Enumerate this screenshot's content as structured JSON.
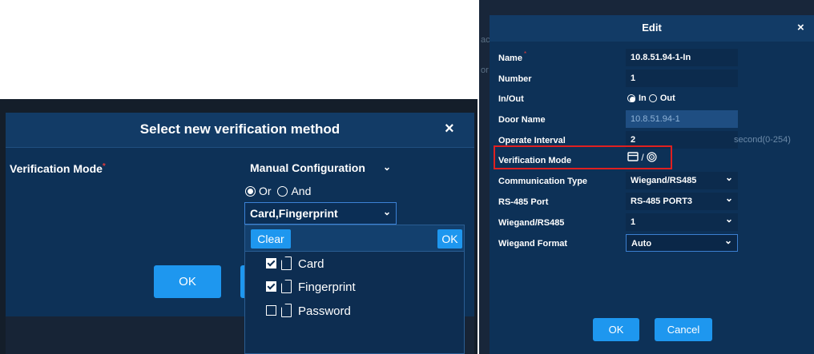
{
  "left_dialog": {
    "title": "Select new verification method",
    "close_symbol": "×",
    "verification_mode_label": "Verification Mode",
    "required_mark": "*",
    "mode_select_value": "Manual Configuration",
    "logic": {
      "or_label": "Or",
      "and_label": "And",
      "selected": "Or"
    },
    "method_select_value": "Card,Fingerprint",
    "ok_label": "OK",
    "dropdown": {
      "clear_label": "Clear",
      "ok_label": "OK",
      "options": [
        {
          "label": "Card",
          "checked": true
        },
        {
          "label": "Fingerprint",
          "checked": true
        },
        {
          "label": "Password",
          "checked": false
        }
      ]
    }
  },
  "right_dialog": {
    "title": "Edit",
    "close_symbol": "×",
    "fields": {
      "name": {
        "label": "Name",
        "value": "10.8.51.94-1-In"
      },
      "number": {
        "label": "Number",
        "value": "1"
      },
      "inout": {
        "label": "In/Out",
        "in_label": "In",
        "out_label": "Out",
        "selected": "In"
      },
      "door_name": {
        "label": "Door Name",
        "value": "10.8.51.94-1"
      },
      "operate_interval": {
        "label": "Operate Interval",
        "value": "2",
        "suffix": "second(0-254)"
      },
      "verification_mode": {
        "label": "Verification Mode",
        "value_icons": [
          "card-icon",
          "fingerprint-icon"
        ],
        "separator": "/"
      },
      "communication_type": {
        "label": "Communication Type",
        "value": "Wiegand/RS485"
      },
      "rs485_port": {
        "label": "RS-485 Port",
        "value": "RS-485 PORT3"
      },
      "wiegand_rs485": {
        "label": "Wiegand/RS485",
        "value": "1"
      },
      "wiegand_format": {
        "label": "Wiegand Format",
        "value": "Auto"
      }
    },
    "ok_label": "OK",
    "cancel_label": "Cancel",
    "background_fragments": [
      "ac",
      "or"
    ]
  },
  "colors": {
    "dialog_bg": "#0d3157",
    "header_bg": "#123b66",
    "accent_button": "#1e97ef",
    "highlight_red": "#e02020"
  }
}
